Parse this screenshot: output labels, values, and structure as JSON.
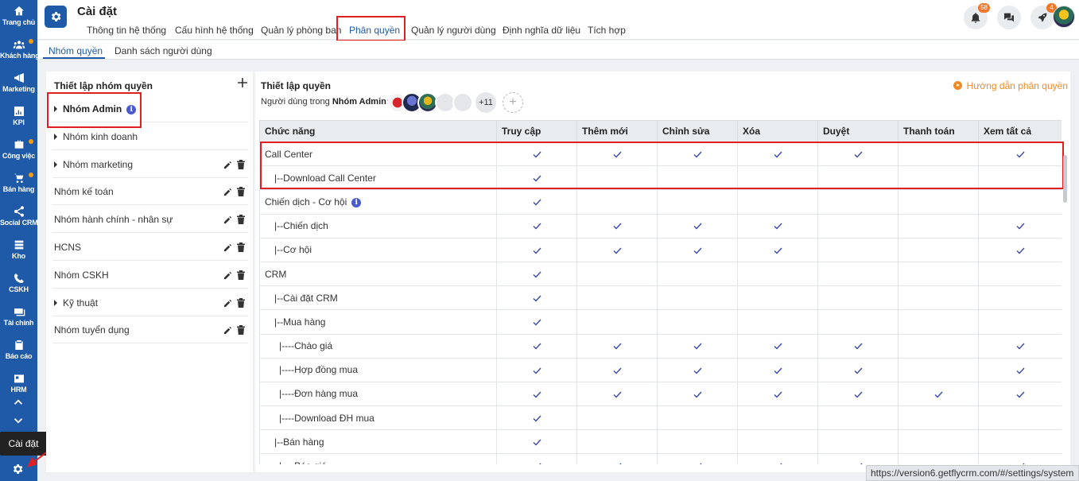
{
  "sidebar": {
    "items": [
      {
        "label": "Trang chủ",
        "icon": "home-icon",
        "dot": false
      },
      {
        "label": "Khách hàng",
        "icon": "users-icon",
        "dot": true
      },
      {
        "label": "Marketing",
        "icon": "megaphone-icon",
        "dot": false
      },
      {
        "label": "KPI",
        "icon": "chart-icon",
        "dot": false
      },
      {
        "label": "Công việc",
        "icon": "briefcase-icon",
        "dot": true
      },
      {
        "label": "Bán hàng",
        "icon": "cart-icon",
        "dot": true
      },
      {
        "label": "Social CRM",
        "icon": "share-icon",
        "dot": false
      },
      {
        "label": "Kho",
        "icon": "warehouse-icon",
        "dot": false
      },
      {
        "label": "CSKH",
        "icon": "phone-icon",
        "dot": false
      },
      {
        "label": "Tài chính",
        "icon": "money-icon",
        "dot": false
      },
      {
        "label": "Báo cáo",
        "icon": "clipboard-icon",
        "dot": false
      },
      {
        "label": "HRM",
        "icon": "id-card-icon",
        "dot": false
      }
    ],
    "tooltip": "Cài đặt"
  },
  "header": {
    "title": "Cài đặt",
    "tabs": [
      "Thông tin hệ thống",
      "Cấu hình hệ thống",
      "Quản lý phòng ban",
      "Phân quyền",
      "Quản lý người dùng",
      "Định nghĩa dữ liệu",
      "Tích hợp"
    ],
    "active_tab": "Phân quyền",
    "notifications_badge": "58",
    "rocket_badge": "4"
  },
  "subtabs": {
    "items": [
      "Nhóm quyền",
      "Danh sách người dùng"
    ],
    "active": "Nhóm quyền"
  },
  "groups_panel": {
    "title": "Thiết lập nhóm quyền",
    "groups": [
      {
        "name": "Nhóm Admin",
        "expandable": true,
        "bold": true,
        "info": true,
        "actions": false
      },
      {
        "name": "Nhóm kinh doanh",
        "expandable": true,
        "bold": false,
        "info": false,
        "actions": false
      },
      {
        "name": "Nhóm marketing",
        "expandable": true,
        "bold": false,
        "info": false,
        "actions": true
      },
      {
        "name": "Nhóm kế toán",
        "expandable": false,
        "bold": false,
        "info": false,
        "actions": true
      },
      {
        "name": "Nhóm hành chính - nhân sự",
        "expandable": false,
        "bold": false,
        "info": false,
        "actions": true
      },
      {
        "name": "HCNS",
        "expandable": false,
        "bold": false,
        "info": false,
        "actions": true
      },
      {
        "name": "Nhóm CSKH",
        "expandable": false,
        "bold": false,
        "info": false,
        "actions": true
      },
      {
        "name": "Kỹ thuật",
        "expandable": true,
        "bold": false,
        "info": false,
        "actions": true
      },
      {
        "name": "Nhóm tuyển dụng",
        "expandable": false,
        "bold": false,
        "info": false,
        "actions": true
      }
    ]
  },
  "permissions_panel": {
    "title": "Thiết lập quyền",
    "users_label_prefix": "Người dùng trong",
    "users_label_group": "Nhóm Admin:",
    "more_users": "+11",
    "add_user": "+",
    "guide_link": "Hướng dẫn phân quyền",
    "columns": [
      "Chức năng",
      "Truy cập",
      "Thêm mới",
      "Chỉnh sửa",
      "Xóa",
      "Duyệt",
      "Thanh toán",
      "Xem tất cả"
    ],
    "rows": [
      {
        "name": "Call Center",
        "info": false,
        "checks": [
          true,
          true,
          true,
          true,
          true,
          false,
          true
        ]
      },
      {
        "name": "|--Download Call Center",
        "info": false,
        "checks": [
          true,
          false,
          false,
          false,
          false,
          false,
          false
        ]
      },
      {
        "name": "Chiến dịch - Cơ hội",
        "info": true,
        "checks": [
          true,
          false,
          false,
          false,
          false,
          false,
          false
        ]
      },
      {
        "name": "|--Chiến dịch",
        "info": false,
        "checks": [
          true,
          true,
          true,
          true,
          false,
          false,
          true
        ]
      },
      {
        "name": "|--Cơ hội",
        "info": false,
        "checks": [
          true,
          true,
          true,
          true,
          false,
          false,
          true
        ]
      },
      {
        "name": "CRM",
        "info": false,
        "checks": [
          true,
          false,
          false,
          false,
          false,
          false,
          false
        ]
      },
      {
        "name": "|--Cài đặt CRM",
        "info": false,
        "checks": [
          true,
          false,
          false,
          false,
          false,
          false,
          false
        ]
      },
      {
        "name": "|--Mua hàng",
        "info": false,
        "checks": [
          true,
          false,
          false,
          false,
          false,
          false,
          false
        ]
      },
      {
        "name": "|----Chào giá",
        "info": false,
        "checks": [
          true,
          true,
          true,
          true,
          true,
          false,
          true
        ]
      },
      {
        "name": "|----Hợp đồng mua",
        "info": false,
        "checks": [
          true,
          true,
          true,
          true,
          true,
          false,
          true
        ]
      },
      {
        "name": "|----Đơn hàng mua",
        "info": false,
        "checks": [
          true,
          true,
          true,
          true,
          true,
          true,
          true
        ]
      },
      {
        "name": "|----Download ĐH mua",
        "info": false,
        "checks": [
          true,
          false,
          false,
          false,
          false,
          false,
          false
        ]
      },
      {
        "name": "|--Bán hàng",
        "info": false,
        "checks": [
          true,
          false,
          false,
          false,
          false,
          false,
          false
        ]
      },
      {
        "name": "|----Báo giá",
        "info": false,
        "checks": [
          true,
          true,
          true,
          true,
          true,
          false,
          true
        ]
      }
    ]
  },
  "status_url": "https://version6.getflycrm.com/#/settings/system",
  "colors": {
    "brand": "#1e5aa8",
    "highlight": "#e02020",
    "guide": "#f08a24",
    "check": "#3949ab"
  }
}
